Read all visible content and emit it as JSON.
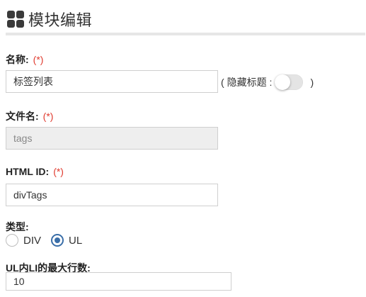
{
  "header": {
    "title": "模块编辑",
    "icon": "grid-icon"
  },
  "form": {
    "name": {
      "label": "名称:",
      "required_mark": "(*)",
      "value": "标签列表"
    },
    "hide_title": {
      "open_paren": "(",
      "label": "隐藏标题 :",
      "close_paren": ")",
      "on": false
    },
    "file_name": {
      "label": "文件名:",
      "required_mark": "(*)",
      "value": "tags"
    },
    "html_id": {
      "label": "HTML ID:",
      "required_mark": "(*)",
      "value": "divTags"
    },
    "type": {
      "label": "类型:",
      "options": [
        {
          "label": "DIV",
          "checked": false
        },
        {
          "label": "UL",
          "checked": true
        }
      ]
    },
    "max_rows": {
      "label": "UL内LI的最大行数:",
      "value": "10"
    }
  },
  "colors": {
    "required": "#e03b2f",
    "radio_accent": "#3a6ea8"
  }
}
